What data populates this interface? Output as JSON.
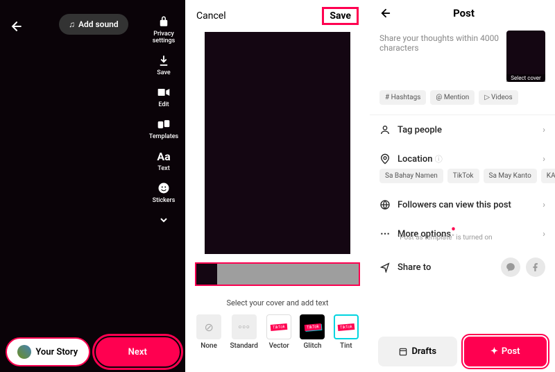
{
  "col1": {
    "add_sound": "Add sound",
    "tools": {
      "privacy": "Privacy settings",
      "save": "Save",
      "edit": "Edit",
      "templates": "Templates",
      "text": "Text",
      "stickers": "Stickers"
    },
    "your_story": "Your Story",
    "next": "Next"
  },
  "col2": {
    "cancel": "Cancel",
    "save": "Save",
    "cover_text": "Select your cover and add text",
    "filters": {
      "none": "None",
      "standard": "Standard",
      "vector": "Vector",
      "glitch": "Glitch",
      "tint": "Tint"
    }
  },
  "col3": {
    "title": "Post",
    "caption_placeholder": "Share your thoughts within 4000 characters",
    "select_cover": "Select cover",
    "chips": {
      "hashtags": "# Hashtags",
      "mention": "@ Mention",
      "videos": "Videos"
    },
    "tag_people": "Tag people",
    "location": "Location",
    "location_chips": [
      "Sa Bahay Namen",
      "TikTok",
      "Sa May Kanto",
      "KAHIT S"
    ],
    "followers": "Followers can view this post",
    "more_options": "More options",
    "more_sub": "\"Post as template\" is turned on",
    "share_to": "Share to",
    "drafts": "Drafts",
    "post": "Post"
  }
}
